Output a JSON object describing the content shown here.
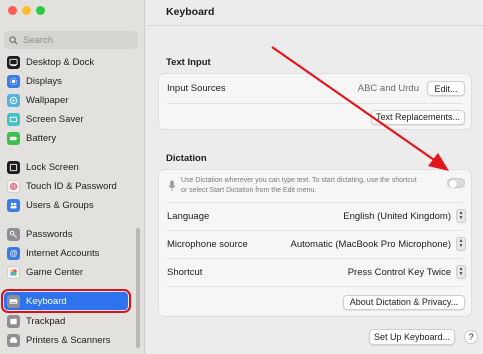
{
  "window": {
    "title": "Keyboard"
  },
  "search": {
    "placeholder": "Search"
  },
  "sidebar": {
    "items": [
      {
        "label": "Desktop & Dock",
        "icon": "dock-icon",
        "color": "#1d1d1f"
      },
      {
        "label": "Displays",
        "icon": "display-icon",
        "color": "#3a7be8"
      },
      {
        "label": "Wallpaper",
        "icon": "wallpaper-icon",
        "color": "#4fb3e8"
      },
      {
        "label": "Screen Saver",
        "icon": "screen-saver-icon",
        "color": "#41c1c8"
      },
      {
        "label": "Battery",
        "icon": "battery-icon",
        "color": "#3cbf4d"
      },
      {
        "label": "Lock Screen",
        "icon": "lock-icon",
        "color": "#1d1d1f"
      },
      {
        "label": "Touch ID & Password",
        "icon": "fingerprint-icon",
        "color": "#f2f2f2"
      },
      {
        "label": "Users & Groups",
        "icon": "users-icon",
        "color": "#3a7be8"
      },
      {
        "label": "Passwords",
        "icon": "key-icon",
        "color": "#8e8e93"
      },
      {
        "label": "Internet Accounts",
        "icon": "at-icon",
        "color": "#3a7be8"
      },
      {
        "label": "Game Center",
        "icon": "game-center-icon",
        "color": "#f2f2f2"
      },
      {
        "label": "Keyboard",
        "icon": "keyboard-icon",
        "color": "#8e8e93"
      },
      {
        "label": "Trackpad",
        "icon": "trackpad-icon",
        "color": "#8e8e93"
      },
      {
        "label": "Printers & Scanners",
        "icon": "printer-icon",
        "color": "#8e8e93"
      }
    ],
    "selected": "Keyboard"
  },
  "text_input": {
    "title": "Text Input",
    "input_sources_label": "Input Sources",
    "input_sources_value": "ABC and Urdu",
    "edit_button": "Edit...",
    "text_replacements_button": "Text Replacements..."
  },
  "dictation": {
    "title": "Dictation",
    "description_line1": "Use Dictation wherever you can type text. To start dictating, use the shortcut",
    "description_line2": "or select Start Dictation from the Edit menu.",
    "enabled": false,
    "language_label": "Language",
    "language_value": "English (United Kingdom)",
    "mic_label": "Microphone source",
    "mic_value": "Automatic (MacBook Pro Microphone)",
    "shortcut_label": "Shortcut",
    "shortcut_value": "Press Control Key Twice",
    "privacy_button": "About Dictation & Privacy..."
  },
  "footer": {
    "setup_button": "Set Up Keyboard...",
    "help": "?"
  },
  "colors": {
    "accent": "#2f72ee",
    "highlight": "#d31420",
    "annotation_arrow": "#e4141b"
  }
}
